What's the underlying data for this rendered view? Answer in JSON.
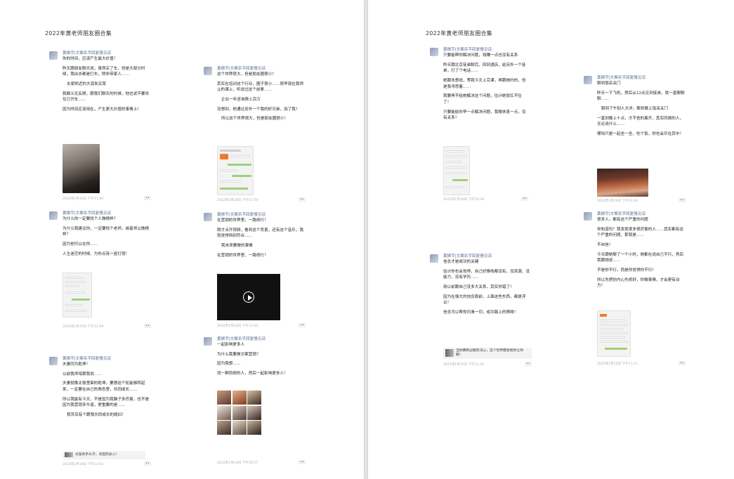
{
  "left_page": {
    "title": "2022年黄老师朋友圈合集",
    "posts": [
      {
        "name": "黄振宇|文案杀手回复慢见谅",
        "paragraphs": [
          "你的时间，应该产生最大价值！",
          "昨天跟朋友聊天说，虽然买了车，但是大部分时候，我出去都是打车，除非带家人……",
          "去家附近的大润发买菜",
          "我都义无反顾，跟我们聊天的时候，他也说不要欢住已开车……",
          "因为时间应该用在，产生更大价值的事情上！"
        ],
        "time": "2022年1月16日 下午11:00"
      },
      {
        "name": "黄振宇|文案杀手回复慢见谅",
        "paragraphs": [
          "这个世界很大，但是朋友圈很小！",
          "其实在培训这个行业，圈子很小……很早就在我师父的课上，听说过这个前辈……",
          "企业一年咨询费上百万",
          "没想到，他通过另外一个我的好兄弟，加了我！",
          "所以这个世界很大，但是朋友圈很小！"
        ],
        "time": "2022年1月16日 下午11:59"
      },
      {
        "name": "黄振宇|文案杀手回复慢见谅",
        "paragraphs": [
          "为什么你一定要找个人做榜样？",
          "为什么我建议你，一定要找个老师，或者师父做榜样？",
          "因为他可以在你……",
          "人生迷茫的时候，为你点亮一座灯塔！"
        ],
        "time": "2022年1月15日 下午11:59"
      },
      {
        "name": "黄振宇|文案杀手回复慢见谅",
        "paragraphs": [
          "在营销的世界里，一路修行！",
          "刚才点开视频，看到这个背景，还有这个音乐，我就觉得特别符合……",
          "我未来要做的事情",
          "在营销的世界里，一路修行！"
        ],
        "time": "2022年1月14日 下午11:04"
      },
      {
        "name": "黄振宇|文案杀手回复慢见谅",
        "paragraphs": [
          "夫妻同为乾坤！",
          "以前我师母跟我说……",
          "夫妻就像太极里面的乾坤，要想这个轮能够转起来，一定要在自己的角色里，共同成长……",
          "所以我能有今天，不是因为我脑子多厉害，也不是因为我营销多牛逼，更重要的是……",
          "我背后有个跟我共同成长的媳妇！"
        ],
        "quote": "文案杀手头子，背后的女人！",
        "time": "2022年1月14日 下午11:02"
      },
      {
        "name": "黄振宇|文案杀手回复慢见谅",
        "paragraphs": [
          "一起影响更多人",
          "为什么我要做文案营销？",
          "因为我想……",
          "找一群同频的人，然后一起影响更多人！"
        ],
        "time": "2022年1月14日 下午10:57"
      }
    ]
  },
  "right_page": {
    "title": "2022年黄老师朋友圈合集",
    "posts": [
      {
        "name": "黄振宇|文案杀手回复慢见谅",
        "paragraphs": [
          "只要能帮你解决问题，钱赚一点也没有关系",
          "昨天跟北京徒弟聊完，回到酒店，给另外一个徒弟，打了个电话……",
          "她跟本想说，等我今天上完课，再跟她约的，但是我寻思着……",
          "我要再不给她解决这个问题，估计她就扛不住了！",
          "只要能给你早一点解决问题，我晚休息一点，没有关系！"
        ],
        "time": "2022年1月16日 下午10:36"
      },
      {
        "name": "黄振宇|文案杀手回复慢见谅",
        "paragraphs": [
          "聊到饭店关门",
          "昨天一下飞机，然后从12点见到徒弟，就一直聊聊聊……",
          "聊到下午别人大洋，聊到晚上饭店关门",
          "一直到晚上十点，才不舍的离开，其实同频的人，无论说什么……",
          "哪怕只是一起坐一坐，吃个饭，你也会乐在其中！"
        ],
        "time": "2022年1月16日 下午10:34"
      },
      {
        "name": "黄振宇|文案杀手回复慢见谅",
        "paragraphs": [
          "信念才是成功的关键",
          "估计你也会觉得，自己好像啥都没有，没资源、没能力、没有学历……",
          "用以前跟自己没多大关系，其实你错了！",
          "因为在强大的信念面前，上面这些东西，都是浮云！",
          "信念可以帮你扫清一切，成功路上的障碍！"
        ],
        "quote": "当你拥有必胜的决心，这个世界都会给你让你路！",
        "time": "2022年1月15日 下午11:59"
      },
      {
        "name": "黄振宇|文案杀手回复慢见谅",
        "paragraphs": [
          "很多人，都有这个严重的问题",
          "你知道吗？我发现很多很厉害的人……其实都有这个严重的问题，那就是……",
          "不自信！",
          "今天跟她聊了一个小时，她都在说自己不行，然后我跟她说……",
          "不是你不行，而是你觉得你不行！",
          "所以先把你内心先修好，你做事情，才会更有动力！"
        ],
        "time": "2022年1月15日 下午11:11"
      }
    ]
  },
  "ui": {
    "more_glyph": "••"
  }
}
